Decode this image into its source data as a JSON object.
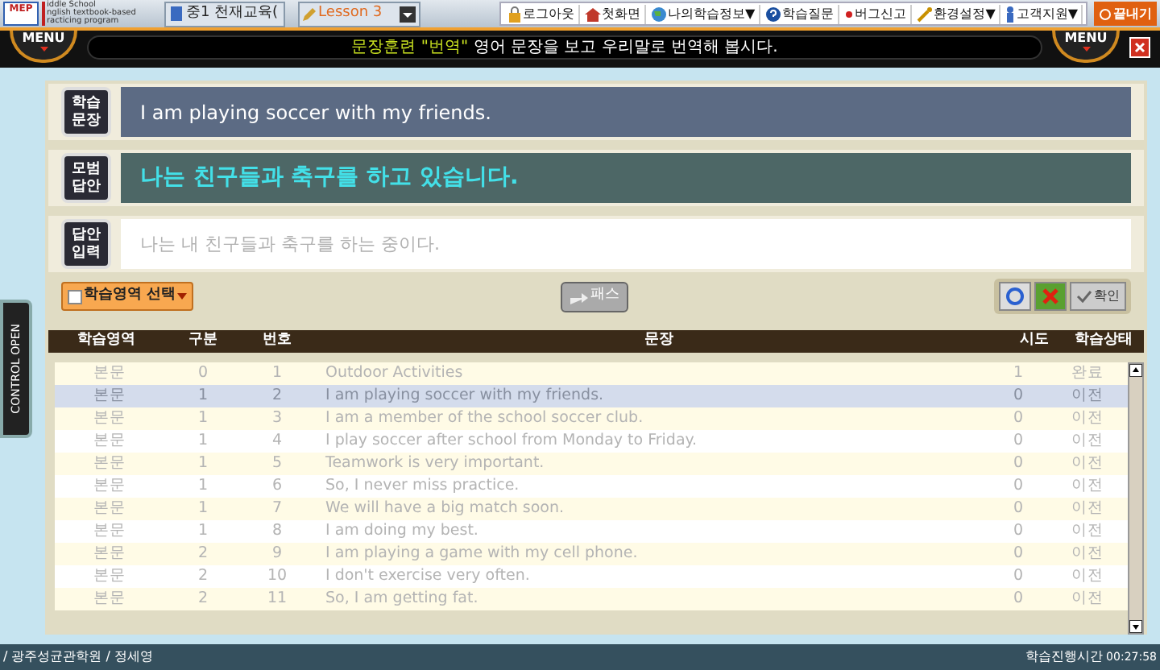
{
  "logo": {
    "mark": "MEP",
    "lines": [
      "iddle School",
      "nglish textbook-based",
      "racticing program"
    ]
  },
  "course": {
    "textbook": "중1 천재교육(",
    "lesson": "Lesson 3"
  },
  "menu": [
    "로그아웃",
    "첫화면",
    "나의학습정보▼",
    "학습질문",
    "버그신고",
    "환경설정▼",
    "고객지원▼"
  ],
  "exit_button": "끝내기",
  "menu_buttons": [
    "MENU",
    "MENU"
  ],
  "banner": {
    "highlight": "문장훈련 \"번역\"",
    "text": "영어 문장을 보고 우리말로 번역해 봅시다."
  },
  "side_tab": "CONTROL OPEN",
  "panels": [
    {
      "label": "학습\n문장",
      "kind": "sentence",
      "text": "I am playing soccer with my friends."
    },
    {
      "label": "모범\n답안",
      "kind": "model",
      "text": "나는 친구들과 축구를 하고 있습니다."
    },
    {
      "label": "답안\n입력",
      "kind": "input",
      "placeholder": "나는 내 친구들과 축구를 하는 중이다."
    }
  ],
  "area_select": "학습영역 선택",
  "pass_button": "패스",
  "confirm_button": "확인",
  "table": {
    "columns": [
      "학습영역",
      "구분",
      "번호",
      "문장",
      "시도",
      "학습상태"
    ],
    "rows": [
      {
        "cells": [
          "본문",
          "0",
          "1",
          "Outdoor Activities",
          "1",
          "완료"
        ],
        "selected": false
      },
      {
        "cells": [
          "본문",
          "1",
          "2",
          "I am playing soccer with my friends.",
          "0",
          "이전"
        ],
        "selected": true
      },
      {
        "cells": [
          "본문",
          "1",
          "3",
          "I am a member of the school soccer club.",
          "0",
          "이전"
        ],
        "selected": false
      },
      {
        "cells": [
          "본문",
          "1",
          "4",
          "I play soccer after school from Monday to Friday.",
          "0",
          "이전"
        ],
        "selected": false
      },
      {
        "cells": [
          "본문",
          "1",
          "5",
          "Teamwork is very important.",
          "0",
          "이전"
        ],
        "selected": false
      },
      {
        "cells": [
          "본문",
          "1",
          "6",
          "So, I never miss practice.",
          "0",
          "이전"
        ],
        "selected": false
      },
      {
        "cells": [
          "본문",
          "1",
          "7",
          "We will have a big match soon.",
          "0",
          "이전"
        ],
        "selected": false
      },
      {
        "cells": [
          "본문",
          "1",
          "8",
          "I am doing my best.",
          "0",
          "이전"
        ],
        "selected": false
      },
      {
        "cells": [
          "본문",
          "2",
          "9",
          "I am playing a game with my cell phone.",
          "0",
          "이전"
        ],
        "selected": false
      },
      {
        "cells": [
          "본문",
          "2",
          "10",
          "I don't exercise very often.",
          "0",
          "이전"
        ],
        "selected": false
      },
      {
        "cells": [
          "본문",
          "2",
          "11",
          "So, I am getting fat.",
          "0",
          "이전"
        ],
        "selected": false
      }
    ]
  },
  "status_bar": {
    "user": "/ 광주성균관학원 / 정세영",
    "time_label": "학습진행시간",
    "time": "00:27:58"
  }
}
